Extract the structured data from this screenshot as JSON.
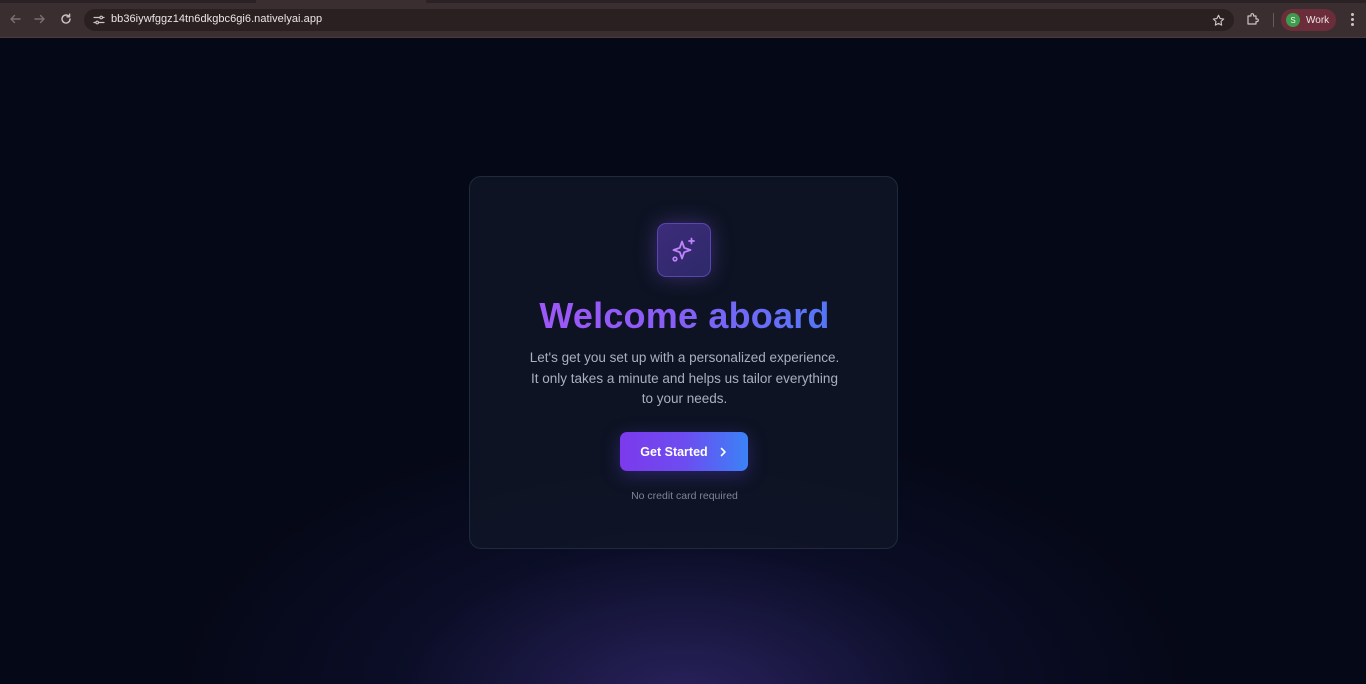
{
  "browser": {
    "url": "bb36iywfggz14tn6dkgbc6gi6.nativelyai.app",
    "profile_initial": "S",
    "profile_name": "Work",
    "icons": {
      "back": "arrow-left-icon",
      "forward": "arrow-right-icon",
      "reload": "reload-icon",
      "site_settings": "tune-icon",
      "bookmark": "star-icon",
      "extensions": "puzzle-icon",
      "menu": "kebab-menu-icon"
    }
  },
  "welcome": {
    "icon": "sparkles-icon",
    "title": "Welcome aboard",
    "subtitle": "Let's get you set up with a personalized experience. It only takes a minute and helps us tailor everything to your needs.",
    "cta_label": "Get Started",
    "cta_icon": "chevron-right-icon",
    "footnote": "No credit card required"
  },
  "colors": {
    "background": "#050816",
    "card": "#111827",
    "accent_purple": "#7c3aed",
    "accent_blue": "#3b82f6",
    "title_gradient_start": "#a855f7",
    "title_gradient_end": "#3b82f6",
    "profile_pill": "#6b2d3a"
  }
}
